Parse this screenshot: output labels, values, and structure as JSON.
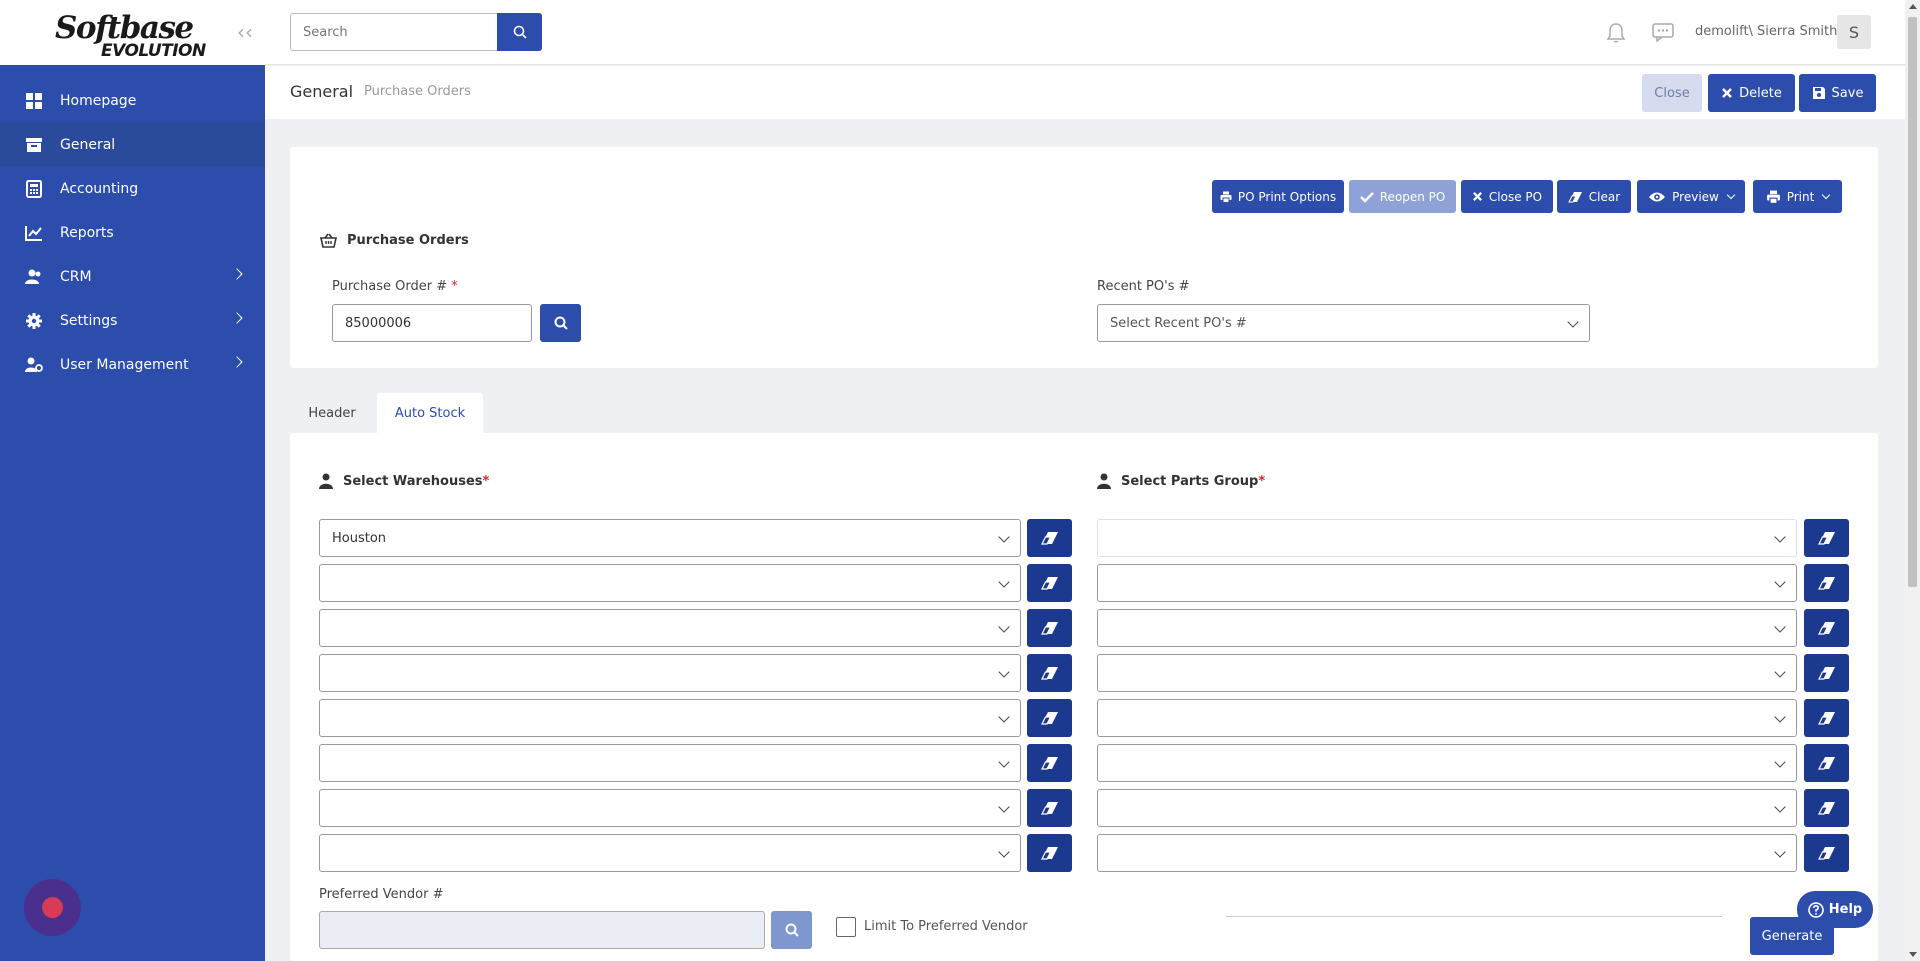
{
  "app": {
    "logo_line1": "Softbase",
    "logo_line2": "EVOLUTION"
  },
  "sidebar": {
    "items": [
      {
        "label": "Homepage",
        "icon": "grid-icon"
      },
      {
        "label": "General",
        "icon": "archive-icon",
        "active": true
      },
      {
        "label": "Accounting",
        "icon": "calculator-icon"
      },
      {
        "label": "Reports",
        "icon": "chart-icon"
      },
      {
        "label": "CRM",
        "icon": "users-icon",
        "has_children": true
      },
      {
        "label": "Settings",
        "icon": "gear-icon",
        "has_children": true
      },
      {
        "label": "User Management",
        "icon": "user-gear-icon",
        "has_children": true
      }
    ]
  },
  "topbar": {
    "search_placeholder": "Search",
    "user": "demolift\\ Sierra Smith",
    "avatar_initial": "S"
  },
  "breadcrumb": {
    "section": "General",
    "page": "Purchase Orders"
  },
  "toolbar": {
    "close_label": "Close",
    "delete_label": "Delete",
    "save_label": "Save"
  },
  "po_card": {
    "title": "Purchase Orders",
    "actions": {
      "print_options": "PO Print Options",
      "reopen": "Reopen PO",
      "close_po": "Close PO",
      "clear": "Clear",
      "preview": "Preview",
      "print": "Print"
    },
    "po_number_label": "Purchase Order #",
    "po_number_value": "85000006",
    "recent_label": "Recent PO's #",
    "recent_placeholder": "Select Recent PO's #"
  },
  "tabs": [
    {
      "label": "Header",
      "active": false
    },
    {
      "label": "Auto Stock",
      "active": true
    }
  ],
  "auto_stock": {
    "warehouses_title": "Select Warehouses",
    "parts_group_title": "Select Parts Group",
    "warehouses": [
      "Houston",
      "",
      "",
      "",
      "",
      "",
      "",
      ""
    ],
    "parts_groups": [
      "",
      "",
      "",
      "",
      "",
      "",
      "",
      ""
    ],
    "preferred_vendor_label": "Preferred Vendor #",
    "preferred_vendor_value": "",
    "limit_label": "Limit To Preferred Vendor",
    "generate_label": "Generate"
  },
  "help_label": "Help",
  "colors": {
    "primary": "#2c4dab",
    "sidebar": "#2c4dab",
    "required": "#d9232e"
  }
}
